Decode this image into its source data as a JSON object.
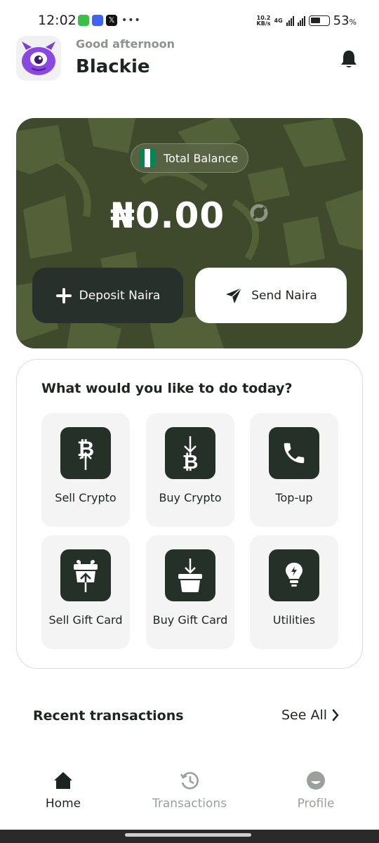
{
  "status_bar": {
    "time": "12:02",
    "net_speed_top": "10.2",
    "net_speed_bottom": "KB/s",
    "network_type": "4G",
    "battery_percent": "53",
    "battery_suffix": "%",
    "notification_icons": [
      "message-icon",
      "chat-app-icon",
      "x-app-icon"
    ],
    "more_dots": "•••"
  },
  "header": {
    "greeting": "Good afternoon",
    "username": "Blackie"
  },
  "balance": {
    "label": "Total Balance",
    "amount": "₦0.00",
    "deposit_label": "Deposit Naira",
    "send_label": "Send Naira"
  },
  "actions": {
    "title": "What would you like to do today?",
    "items": [
      {
        "label": "Sell Crypto",
        "icon": "sell-crypto-icon"
      },
      {
        "label": "Buy Crypto",
        "icon": "buy-crypto-icon"
      },
      {
        "label": "Top-up",
        "icon": "phone-icon"
      },
      {
        "label": "Sell Gift Card",
        "icon": "sell-gift-card-icon"
      },
      {
        "label": "Buy Gift Card",
        "icon": "buy-gift-card-icon"
      },
      {
        "label": "Utilities",
        "icon": "lightbulb-icon"
      }
    ]
  },
  "recent": {
    "title": "Recent transactions",
    "see_all": "See All"
  },
  "nav": {
    "home": "Home",
    "transactions": "Transactions",
    "profile": "Profile",
    "active_color": "#1d2520",
    "inactive_color": "#9aa09b"
  },
  "colors": {
    "card_bg": "#3f4a2c",
    "primary_dark": "#243028",
    "flag_green": "#008751"
  }
}
